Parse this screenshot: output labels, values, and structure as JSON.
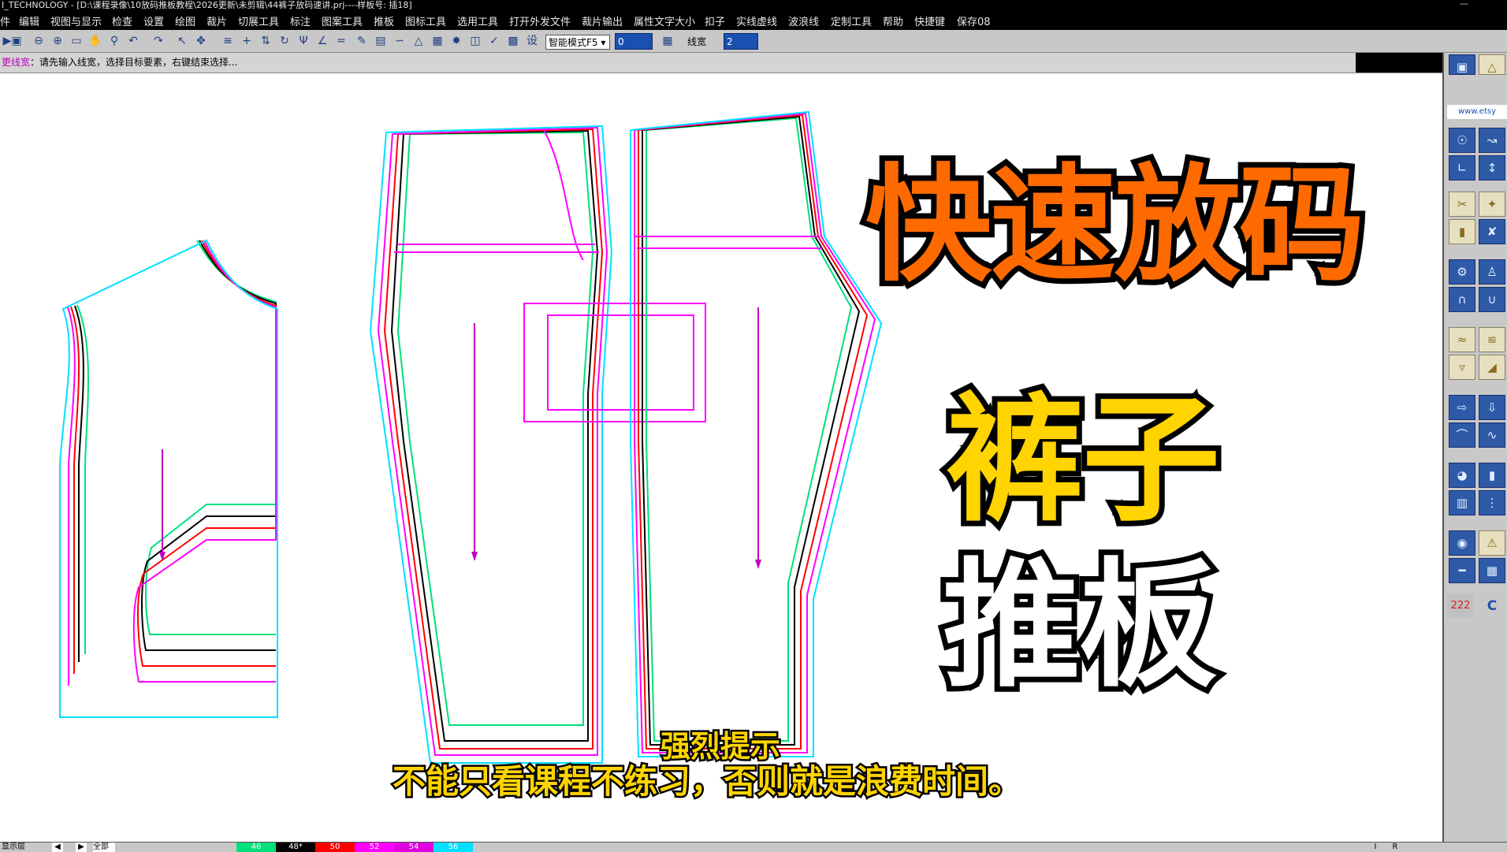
{
  "window": {
    "title": "I_TECHNOLOGY - [D:\\课程录像\\10放码推板教程\\2026更新\\未剪辑\\44裤子放码速讲.prj----样板号: 插18]",
    "minimize_symbol": "—"
  },
  "menu": {
    "items": [
      "件",
      "编辑",
      "视图与显示",
      "检查",
      "设置",
      "绘图",
      "裁片",
      "切展工具",
      "标注",
      "图案工具",
      "推板",
      "图标工具",
      "选用工具",
      "打开外发文件",
      "裁片输出",
      "属性文字大小",
      "扣子",
      "实线虚线",
      "波浪线",
      "定制工具",
      "帮助",
      "快捷键",
      "保存08"
    ]
  },
  "toolbar": {
    "settings_glyph": "设",
    "mode_select": "智能模式F5",
    "value_field": "0",
    "linewidth_label": "线宽",
    "linewidth_value": "2"
  },
  "prompt": {
    "command": "更线宽",
    "text": "：请先输入线宽，选择目标要素，右键结束选择..."
  },
  "overlay": {
    "title_line1": "快速放码",
    "title_line2": "裤子",
    "title_line3": "推板",
    "subtitle_line1": "强烈提示",
    "subtitle_line2": "不能只看课程不练习，否则就是浪费时间。"
  },
  "right_panel": {
    "url": "www.etsy",
    "counter": "222",
    "letter": "C"
  },
  "status": {
    "layer_label": "显示层",
    "all_label": "全部",
    "sizes": [
      "46",
      "48*",
      "50",
      "52",
      "54",
      "56"
    ],
    "right_cells": [
      "I",
      "R"
    ]
  },
  "colors": {
    "size_46": "#00e07a",
    "size_48": "#000000",
    "size_50": "#ff0000",
    "size_52": "#ff00ff",
    "size_54": "#e000e0",
    "size_56": "#00e0ff",
    "grain_line": "#c000c0",
    "title_orange": "#ff6a00",
    "title_yellow": "#ffd400"
  }
}
